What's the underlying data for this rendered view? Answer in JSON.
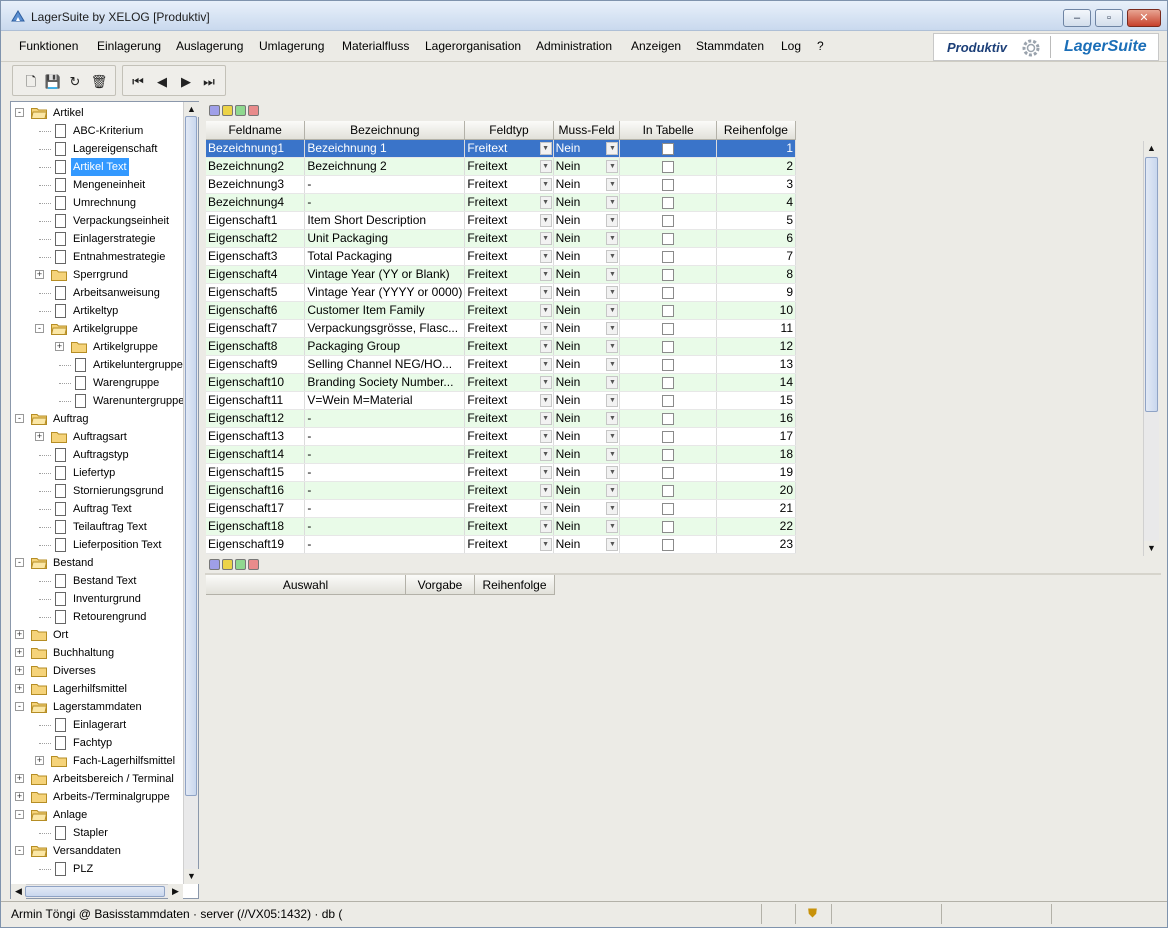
{
  "window": {
    "title": "LagerSuite by XELOG [Produktiv]"
  },
  "menu": [
    "Funktionen",
    "Einlagerung",
    "Auslagerung",
    "Umlagerung",
    "Materialfluss",
    "Lagerorganisation",
    "Administration",
    "Anzeigen",
    "Stammdaten",
    "Log",
    "?"
  ],
  "brand": {
    "mode": "Produktiv",
    "product": "LagerSuite"
  },
  "tree": [
    {
      "label": "Artikel",
      "level": 0,
      "kind": "folder-open",
      "exp": "-"
    },
    {
      "label": "ABC-Kriterium",
      "level": 1,
      "kind": "doc"
    },
    {
      "label": "Lagereigenschaft",
      "level": 1,
      "kind": "doc"
    },
    {
      "label": "Artikel Text",
      "level": 1,
      "kind": "doc",
      "selected": true
    },
    {
      "label": "Mengeneinheit",
      "level": 1,
      "kind": "doc"
    },
    {
      "label": "Umrechnung",
      "level": 1,
      "kind": "doc"
    },
    {
      "label": "Verpackungseinheit",
      "level": 1,
      "kind": "doc"
    },
    {
      "label": "Einlagerstrategie",
      "level": 1,
      "kind": "doc"
    },
    {
      "label": "Entnahmestrategie",
      "level": 1,
      "kind": "doc"
    },
    {
      "label": "Sperrgrund",
      "level": 1,
      "kind": "folder",
      "exp": "+"
    },
    {
      "label": "Arbeitsanweisung",
      "level": 1,
      "kind": "doc"
    },
    {
      "label": "Artikeltyp",
      "level": 1,
      "kind": "doc"
    },
    {
      "label": "Artikelgruppe",
      "level": 1,
      "kind": "folder-open",
      "exp": "-"
    },
    {
      "label": "Artikelgruppe",
      "level": 2,
      "kind": "folder",
      "exp": "+"
    },
    {
      "label": "Artikeluntergruppe",
      "level": 2,
      "kind": "doc"
    },
    {
      "label": "Warengruppe",
      "level": 2,
      "kind": "doc"
    },
    {
      "label": "Warenuntergruppe",
      "level": 2,
      "kind": "doc"
    },
    {
      "label": "Auftrag",
      "level": 0,
      "kind": "folder-open",
      "exp": "-"
    },
    {
      "label": "Auftragsart",
      "level": 1,
      "kind": "folder",
      "exp": "+"
    },
    {
      "label": "Auftragstyp",
      "level": 1,
      "kind": "doc"
    },
    {
      "label": "Liefertyp",
      "level": 1,
      "kind": "doc"
    },
    {
      "label": "Stornierungsgrund",
      "level": 1,
      "kind": "doc"
    },
    {
      "label": "Auftrag Text",
      "level": 1,
      "kind": "doc"
    },
    {
      "label": "Teilauftrag Text",
      "level": 1,
      "kind": "doc"
    },
    {
      "label": "Lieferposition Text",
      "level": 1,
      "kind": "doc"
    },
    {
      "label": "Bestand",
      "level": 0,
      "kind": "folder-open",
      "exp": "-"
    },
    {
      "label": "Bestand Text",
      "level": 1,
      "kind": "doc"
    },
    {
      "label": "Inventurgrund",
      "level": 1,
      "kind": "doc"
    },
    {
      "label": "Retourengrund",
      "level": 1,
      "kind": "doc"
    },
    {
      "label": "Ort",
      "level": 0,
      "kind": "folder",
      "exp": "+"
    },
    {
      "label": "Buchhaltung",
      "level": 0,
      "kind": "folder",
      "exp": "+"
    },
    {
      "label": "Diverses",
      "level": 0,
      "kind": "folder",
      "exp": "+"
    },
    {
      "label": "Lagerhilfsmittel",
      "level": 0,
      "kind": "folder",
      "exp": "+"
    },
    {
      "label": "Lagerstammdaten",
      "level": 0,
      "kind": "folder-open",
      "exp": "-"
    },
    {
      "label": "Einlagerart",
      "level": 1,
      "kind": "doc"
    },
    {
      "label": "Fachtyp",
      "level": 1,
      "kind": "doc"
    },
    {
      "label": "Fach-Lagerhilfsmittel",
      "level": 1,
      "kind": "folder",
      "exp": "+"
    },
    {
      "label": "Arbeitsbereich / Terminal",
      "level": 0,
      "kind": "folder",
      "exp": "+"
    },
    {
      "label": "Arbeits-/Terminalgruppe",
      "level": 0,
      "kind": "folder",
      "exp": "+"
    },
    {
      "label": "Anlage",
      "level": 0,
      "kind": "folder-open",
      "exp": "-"
    },
    {
      "label": "Stapler",
      "level": 1,
      "kind": "doc"
    },
    {
      "label": "Versanddaten",
      "level": 0,
      "kind": "folder-open",
      "exp": "-"
    },
    {
      "label": "PLZ",
      "level": 1,
      "kind": "doc"
    }
  ],
  "grid": {
    "columns": [
      "Feldname",
      "Bezeichnung",
      "Feldtyp",
      "Muss-Feld",
      "In Tabelle",
      "Reihenfolge"
    ],
    "rows": [
      {
        "feldname": "Bezeichnung1",
        "bez": "Bezeichnung 1",
        "typ": "Freitext",
        "muss": "Nein",
        "order": "1",
        "checked": false
      },
      {
        "feldname": "Bezeichnung2",
        "bez": "Bezeichnung 2",
        "typ": "Freitext",
        "muss": "Nein",
        "order": "2",
        "checked": false
      },
      {
        "feldname": "Bezeichnung3",
        "bez": "-",
        "typ": "Freitext",
        "muss": "Nein",
        "order": "3",
        "checked": false
      },
      {
        "feldname": "Bezeichnung4",
        "bez": "-",
        "typ": "Freitext",
        "muss": "Nein",
        "order": "4",
        "checked": false
      },
      {
        "feldname": "Eigenschaft1",
        "bez": "Item Short Description",
        "typ": "Freitext",
        "muss": "Nein",
        "order": "5",
        "checked": false
      },
      {
        "feldname": "Eigenschaft2",
        "bez": "Unit Packaging",
        "typ": "Freitext",
        "muss": "Nein",
        "order": "6",
        "checked": false
      },
      {
        "feldname": "Eigenschaft3",
        "bez": "Total Packaging",
        "typ": "Freitext",
        "muss": "Nein",
        "order": "7",
        "checked": false
      },
      {
        "feldname": "Eigenschaft4",
        "bez": "Vintage Year (YY or Blank)",
        "typ": "Freitext",
        "muss": "Nein",
        "order": "8",
        "checked": false
      },
      {
        "feldname": "Eigenschaft5",
        "bez": "Vintage Year (YYYY or 0000)",
        "typ": "Freitext",
        "muss": "Nein",
        "order": "9",
        "checked": false
      },
      {
        "feldname": "Eigenschaft6",
        "bez": "Customer Item Family",
        "typ": "Freitext",
        "muss": "Nein",
        "order": "10",
        "checked": false
      },
      {
        "feldname": "Eigenschaft7",
        "bez": "Verpackungsgrösse, Flasc...",
        "typ": "Freitext",
        "muss": "Nein",
        "order": "11",
        "checked": false
      },
      {
        "feldname": "Eigenschaft8",
        "bez": "Packaging Group",
        "typ": "Freitext",
        "muss": "Nein",
        "order": "12",
        "checked": false
      },
      {
        "feldname": "Eigenschaft9",
        "bez": "Selling Channel   NEG/HO...",
        "typ": "Freitext",
        "muss": "Nein",
        "order": "13",
        "checked": false
      },
      {
        "feldname": "Eigenschaft10",
        "bez": "Branding Society Number...",
        "typ": "Freitext",
        "muss": "Nein",
        "order": "14",
        "checked": false
      },
      {
        "feldname": "Eigenschaft11",
        "bez": "V=Wein M=Material",
        "typ": "Freitext",
        "muss": "Nein",
        "order": "15",
        "checked": false
      },
      {
        "feldname": "Eigenschaft12",
        "bez": "-",
        "typ": "Freitext",
        "muss": "Nein",
        "order": "16",
        "checked": false
      },
      {
        "feldname": "Eigenschaft13",
        "bez": "-",
        "typ": "Freitext",
        "muss": "Nein",
        "order": "17",
        "checked": false
      },
      {
        "feldname": "Eigenschaft14",
        "bez": "-",
        "typ": "Freitext",
        "muss": "Nein",
        "order": "18",
        "checked": false
      },
      {
        "feldname": "Eigenschaft15",
        "bez": "-",
        "typ": "Freitext",
        "muss": "Nein",
        "order": "19",
        "checked": false
      },
      {
        "feldname": "Eigenschaft16",
        "bez": "-",
        "typ": "Freitext",
        "muss": "Nein",
        "order": "20",
        "checked": false
      },
      {
        "feldname": "Eigenschaft17",
        "bez": "-",
        "typ": "Freitext",
        "muss": "Nein",
        "order": "21",
        "checked": false
      },
      {
        "feldname": "Eigenschaft18",
        "bez": "-",
        "typ": "Freitext",
        "muss": "Nein",
        "order": "22",
        "checked": false
      },
      {
        "feldname": "Eigenschaft19",
        "bez": "-",
        "typ": "Freitext",
        "muss": "Nein",
        "order": "23",
        "checked": false
      }
    ]
  },
  "grid2": {
    "columns": [
      "Auswahl",
      "Vorgabe",
      "Reihenfolge"
    ]
  },
  "status": {
    "text": "Armin Töngi @ Basisstammdaten · server (//VX05:1432) · db ("
  },
  "colors": {
    "selection": "#3a74c9",
    "alt_row": "#e9fbe8",
    "tree_selection": "#3399ff"
  }
}
